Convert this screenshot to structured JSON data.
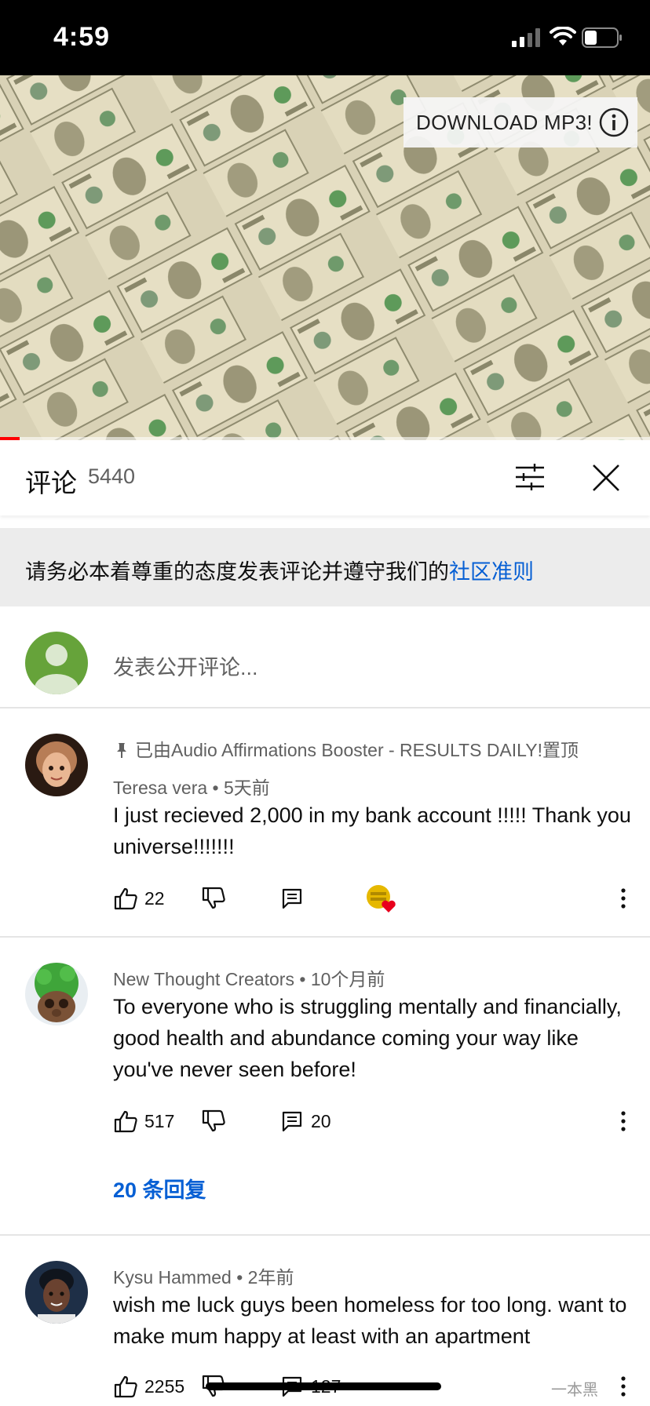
{
  "status_bar": {
    "time": "4:59"
  },
  "video": {
    "download_label": "DOWNLOAD MP3!",
    "progress_fraction": 0.03
  },
  "comments_header": {
    "title": "评论",
    "count": "5440"
  },
  "notice": {
    "text": "请务必本着尊重的态度发表评论并遵守我们的",
    "link": "社区准则"
  },
  "add_comment": {
    "placeholder": "发表公开评论..."
  },
  "comments": [
    {
      "pinned_text": "已由Audio Affirmations Booster - RESULTS DAILY!置顶",
      "author": "Teresa vera",
      "time": "5天前",
      "text": "I just recieved 2,000 in my bank account !!!!! Thank you universe!!!!!!!",
      "likes": "22",
      "replies": ""
    },
    {
      "author": "New Thought Creators",
      "time": "10个月前",
      "text": "To everyone who is struggling mentally and financially,  good health and abundance coming your way like you've never seen before!",
      "likes": "517",
      "replies": "20",
      "replies_link": "20 条回复"
    },
    {
      "author": "Kysu Hammed",
      "time": "2年前",
      "text": "wish me luck guys been homeless for too long. want to make mum happy at least with an apartment",
      "likes": "2255",
      "replies": "127"
    }
  ],
  "watermark": "一本黑",
  "colors": {
    "link": "#065fd4",
    "progress": "#ff0000",
    "notice_bg": "#ececec"
  }
}
